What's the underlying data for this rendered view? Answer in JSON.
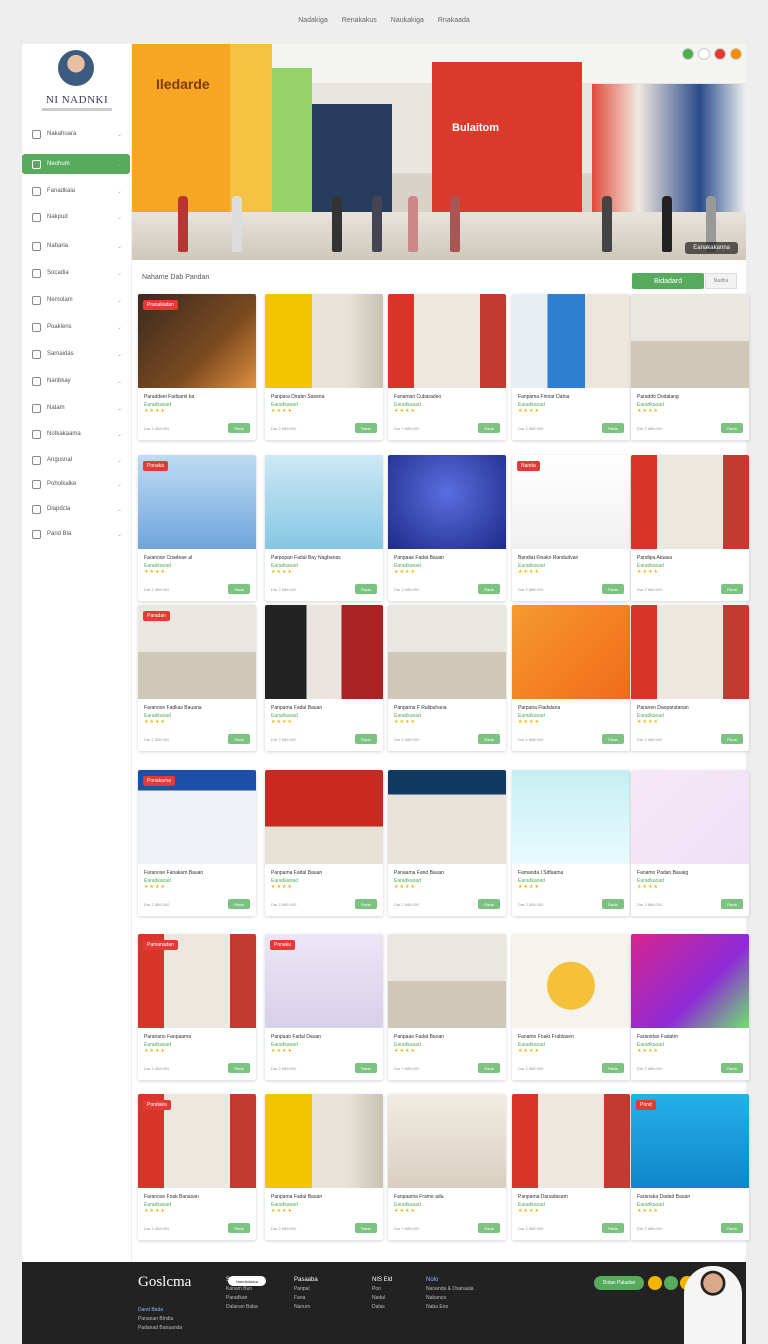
{
  "topnav": [
    "Nadakiga",
    "Renakakus",
    "Naukakiga",
    "Rnakaada"
  ],
  "sidebar": {
    "brand": "NI NADNKI",
    "items": [
      {
        "label": "Nakahuara",
        "icon": "home-icon"
      },
      {
        "label": "Neohum",
        "icon": "shield-icon"
      },
      {
        "label": "Fanadkaia",
        "icon": "heart-icon"
      },
      {
        "label": "Nakpud",
        "icon": "lock-icon"
      },
      {
        "label": "Nabaria",
        "icon": "user-icon"
      },
      {
        "label": "Socadia",
        "icon": "book-icon"
      },
      {
        "label": "Nemolam",
        "icon": "person-icon"
      },
      {
        "label": "Poaklens",
        "icon": "card-icon"
      },
      {
        "label": "Samaidas",
        "icon": "list-icon"
      },
      {
        "label": "Nanbkay",
        "icon": "store-icon"
      },
      {
        "label": "Natam",
        "icon": "chat-icon"
      },
      {
        "label": "Notkakaama",
        "icon": "mail-icon"
      },
      {
        "label": "Angusnal",
        "icon": "cart-icon"
      },
      {
        "label": "Poholkalke",
        "icon": "doc-icon"
      },
      {
        "label": "Dlapdcla",
        "icon": "tag-icon"
      },
      {
        "label": "Pand Bla",
        "icon": "grid-icon"
      }
    ]
  },
  "hero": {
    "banner_a": "Iledarde",
    "banner_b": "Bulaitom",
    "caption": "Eanakakanna"
  },
  "section_title": "Nahame Dab Pandan",
  "filter_label": "Bidadard",
  "filter_alt": "Nadha",
  "cards": [
    {
      "title": "Paraddeei Fadsami ba",
      "sub": "Earadkaoad",
      "stars": "★★★★",
      "price": "Dar 2 888.000",
      "btn": "Rada",
      "badge": "Pranakadan",
      "theme": "phone"
    },
    {
      "title": "Panpara Dirabn Sasena",
      "sub": "Earadkaoad",
      "stars": "★★★★",
      "price": "Dar 2 888.000",
      "btn": "Rada",
      "badge": "",
      "theme": "yellow"
    },
    {
      "title": "Fanaman Cubaradeo",
      "sub": "Earadkaoad",
      "stars": "★★★★",
      "price": "Dar 2 888.000",
      "btn": "Rada",
      "badge": "",
      "theme": "mall-red"
    },
    {
      "title": "Fanpama Finnar Datoa",
      "sub": "Earadkaoad",
      "stars": "★★★★",
      "price": "Dar 2 888.000",
      "btn": "Rada",
      "badge": "",
      "theme": "blue"
    },
    {
      "title": "Paraddo Dodalang",
      "sub": "Earadkaoad",
      "stars": "★★★★",
      "price": "Dar 2 888.000",
      "btn": "Rada",
      "badge": "",
      "theme": "mall"
    },
    {
      "title": "Faranose Cnadeae al",
      "sub": "Earadkaoad",
      "stars": "★★★★",
      "price": "Dar 2 888.000",
      "btn": "Rada",
      "badge": "Ponaka",
      "theme": "sky"
    },
    {
      "title": "Parpopan Fadal Bay Nagbanas",
      "sub": "Earadkaoad",
      "stars": "★★★★",
      "price": "Dar 2 888.000",
      "btn": "Rada",
      "badge": "",
      "theme": "tray"
    },
    {
      "title": "Panpaae Fadat Bauan",
      "sub": "Earadkaoad",
      "stars": "★★★★",
      "price": "Dar 2 888.000",
      "btn": "Rada",
      "badge": "",
      "theme": "indigo"
    },
    {
      "title": "Bandiat Finako Randudvan",
      "sub": "Earadkaoad",
      "stars": "★★★★",
      "price": "Dar 2 888.000",
      "btn": "Rada",
      "badge": "Nanda",
      "theme": "white"
    },
    {
      "title": "Pandipa Ataasa",
      "sub": "Earadkaoad",
      "stars": "★★★★",
      "price": "Dar 2 888.000",
      "btn": "Rada",
      "badge": "",
      "theme": "mall-red"
    },
    {
      "title": "Faranose Fadkas Bauana",
      "sub": "Earadkaoad",
      "stars": "★★★★",
      "price": "Dar 2 888.000",
      "btn": "Rada",
      "badge": "Paradan",
      "theme": "mall"
    },
    {
      "title": "Panpama Fadal Bauan",
      "sub": "Earadkaoad",
      "stars": "★★★★",
      "price": "Dar 2 888.000",
      "btn": "Rada",
      "badge": "",
      "theme": "dark"
    },
    {
      "title": "Panpama F Ralipuhana",
      "sub": "Earadkaoad",
      "stars": "★★★★",
      "price": "Dar 2 888.000",
      "btn": "Rada",
      "badge": "",
      "theme": "mall"
    },
    {
      "title": "Parpana Fladalana",
      "sub": "Earadkaoad",
      "stars": "★★★★",
      "price": "Dar 2 888.000",
      "btn": "Rada",
      "badge": "",
      "theme": "orange"
    },
    {
      "title": "Paranen Daopandanan",
      "sub": "Earadkaoad",
      "stars": "★★★★",
      "price": "Dar 2 888.000",
      "btn": "Rada",
      "badge": "",
      "theme": "mall-red"
    },
    {
      "title": "Faranose Fanakam Bauan",
      "sub": "Earadkaoad",
      "stars": "★★★★",
      "price": "Dar 2 888.000",
      "btn": "Rada",
      "badge": "Ponakama",
      "theme": "store-blue"
    },
    {
      "title": "Panpama Fadal Bauan",
      "sub": "Earadkaoad",
      "stars": "★★★★",
      "price": "Dar 2 888.000",
      "btn": "Rada",
      "badge": "",
      "theme": "red-store"
    },
    {
      "title": "Panaama Fand Bauan",
      "sub": "Earadkaoad",
      "stars": "★★★★",
      "price": "Dar 2 888.000",
      "btn": "Rada",
      "badge": "",
      "theme": "nedo"
    },
    {
      "title": "Famanda I Sdfaama",
      "sub": "Earadkaoad",
      "stars": "★★★★",
      "price": "Dar 2 888.000",
      "btn": "Rada",
      "badge": "",
      "theme": "cards"
    },
    {
      "title": "Fanamo Padan Bauaig",
      "sub": "Earadkaoad",
      "stars": "★★★★",
      "price": "Dar 2 888.000",
      "btn": "Rada",
      "badge": "",
      "theme": "gadgets"
    },
    {
      "title": "Paranano Fanpaama",
      "sub": "Earadkaoad",
      "stars": "★★★★",
      "price": "Dar 2 888.000",
      "btn": "Rada",
      "badge": "Pamanadan",
      "theme": "mall-red"
    },
    {
      "title": "Panpaao Fadal Dauan",
      "sub": "Earadkaoad",
      "stars": "★★★★",
      "price": "Dar 2 888.000",
      "btn": "Rada",
      "badge": "Ponaka",
      "theme": "man"
    },
    {
      "title": "Panpaae Fadat Baoan",
      "sub": "Earadkaoad",
      "stars": "★★★★",
      "price": "Dar 2 888.000",
      "btn": "Rada",
      "badge": "",
      "theme": "mall"
    },
    {
      "title": "Fanamo Fnakt Frablasen",
      "sub": "Earadkaoad",
      "stars": "★★★★",
      "price": "Dar 2 888.000",
      "btn": "Rada",
      "badge": "",
      "theme": "sticker"
    },
    {
      "title": "Faranidan Fadatm",
      "sub": "Earadkaoad",
      "stars": "★★★★",
      "price": "Dar 2 888.000",
      "btn": "Rada",
      "badge": "",
      "theme": "magenta"
    },
    {
      "title": "Faranose Fnak Banasan",
      "sub": "Earadkaoad",
      "stars": "★★★★",
      "price": "Dar 2 888.000",
      "btn": "Rada",
      "badge": "Pondaka",
      "theme": "mall-red"
    },
    {
      "title": "Panpama Fadal Bauan",
      "sub": "Earadkaoad",
      "stars": "★★★★",
      "price": "Dar 2 888.000",
      "btn": "Rada",
      "badge": "",
      "theme": "yellow"
    },
    {
      "title": "Fanpaama Frame ada",
      "sub": "Earadkaoad",
      "stars": "★★★★",
      "price": "Dar 2 888.000",
      "btn": "Rada",
      "badge": "",
      "theme": "gallery"
    },
    {
      "title": "Panpama Danadasam",
      "sub": "Earadkaoad",
      "stars": "★★★★",
      "price": "Dar 2 888.000",
      "btn": "Rada",
      "badge": "",
      "theme": "mall-red"
    },
    {
      "title": "Faranaka Dadad Bauan",
      "sub": "Earadkaoad",
      "stars": "★★★★",
      "price": "Dar 2 888.000",
      "btn": "Rada",
      "badge": "Pond",
      "theme": "man-blue"
    }
  ],
  "footer": {
    "logo": "Goslcma",
    "pill": "Nabdadaara",
    "cols": [
      {
        "h": "Sanaa",
        "items": [
          "Kanam Bun",
          "Paradkan",
          "Dalanan Baba"
        ]
      },
      {
        "h": "Pasaaba",
        "items": [
          "Panpal",
          "Fana",
          "Nanum"
        ]
      },
      {
        "h": "NIS Eld",
        "items": [
          "Poo",
          "Nadal",
          "Dalas"
        ]
      },
      {
        "h": "Nolo",
        "items": [
          "Nananda & Dsanaala",
          "Nabanca",
          "Naba Ene"
        ]
      }
    ],
    "left_links": [
      "Dand Bada",
      "Pananan Blndia",
      "Padanad Banaanda"
    ],
    "cta": "Dolan Paladan"
  }
}
